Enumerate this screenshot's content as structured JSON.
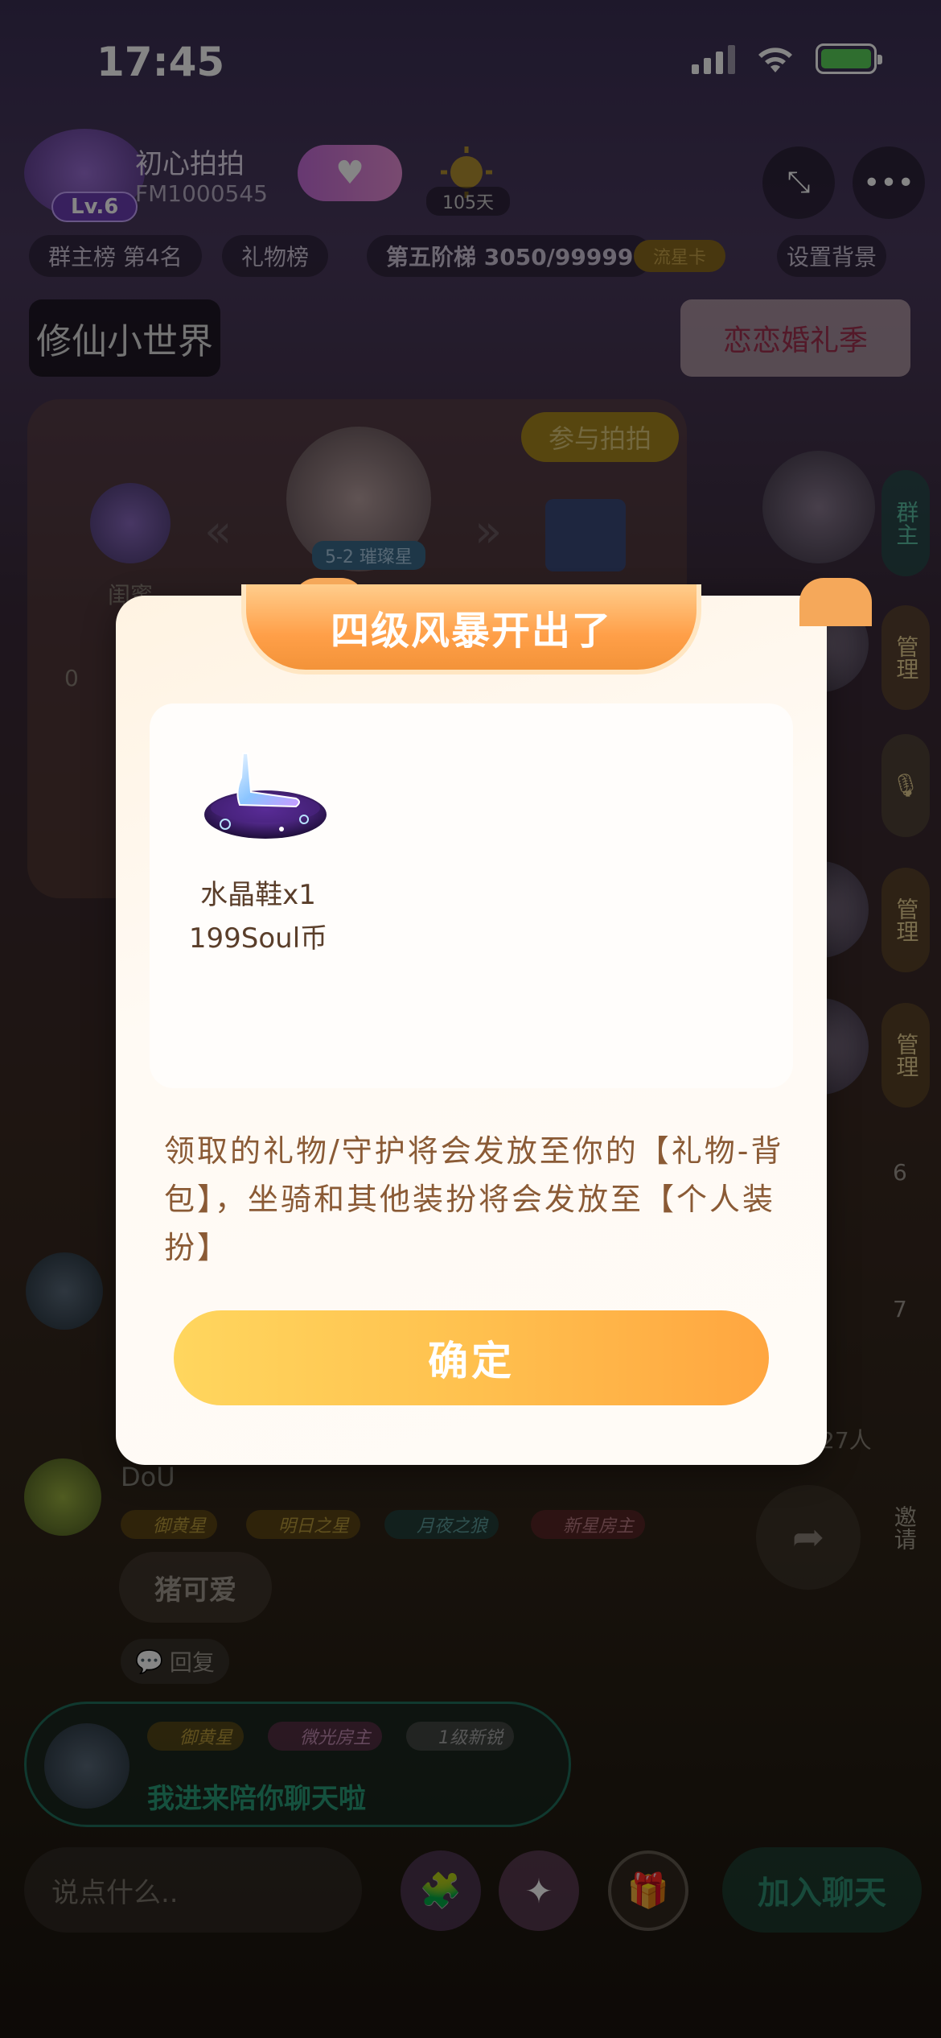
{
  "status_bar": {
    "time": "17:45"
  },
  "room": {
    "level": "Lv.6",
    "name": "初心拍拍",
    "id": "FM1000545",
    "days": "105天",
    "pills": [
      "群主榜 第4名",
      "礼物榜",
      "第五阶梯 3050/99999",
      "流星卡",
      "设置背景"
    ],
    "game_banner": "修仙小世界",
    "wedding_banner": "恋恋婚礼季",
    "join_pat": "参与拍拍",
    "stage_label": "5-2 璀璨星",
    "stage_left_label": "闺蜜",
    "stage_progress_start": "0"
  },
  "side_roles": [
    "群主",
    "管理",
    "管理",
    "管理"
  ],
  "side_counts": [
    "6",
    "7"
  ],
  "online_count": "27人",
  "chat": {
    "user_name": "DoU",
    "tags": [
      "御黄星",
      "明日之星",
      "月夜之狼",
      "新星房主"
    ],
    "message": "猪可爱",
    "reply_label": "回复",
    "invite_label": "邀请",
    "welcome_tags": [
      "御黄星",
      "微光房主",
      "1级新锐"
    ],
    "welcome_text": "我进来陪你聊天啦"
  },
  "bottom_bar": {
    "input_placeholder": "说点什么..",
    "join_chat_label": "加入聊天"
  },
  "modal": {
    "title": "四级风暴开出了",
    "prize": {
      "icon": "crystal-shoe-icon",
      "name": "水晶鞋x1",
      "price": "199Soul币"
    },
    "notice": "领取的礼物/守护将会发放至你的【礼物-背包】，坐骑和其他装扮将会发放至【个人装扮】",
    "confirm_label": "确定"
  },
  "colors": {
    "modal_title_gradient_start": "#ffcd8c",
    "modal_title_gradient_end": "#f39339",
    "confirm_gradient_start": "#ffd65e",
    "confirm_gradient_end": "#ffa640",
    "notice_text": "#8a5a35"
  }
}
